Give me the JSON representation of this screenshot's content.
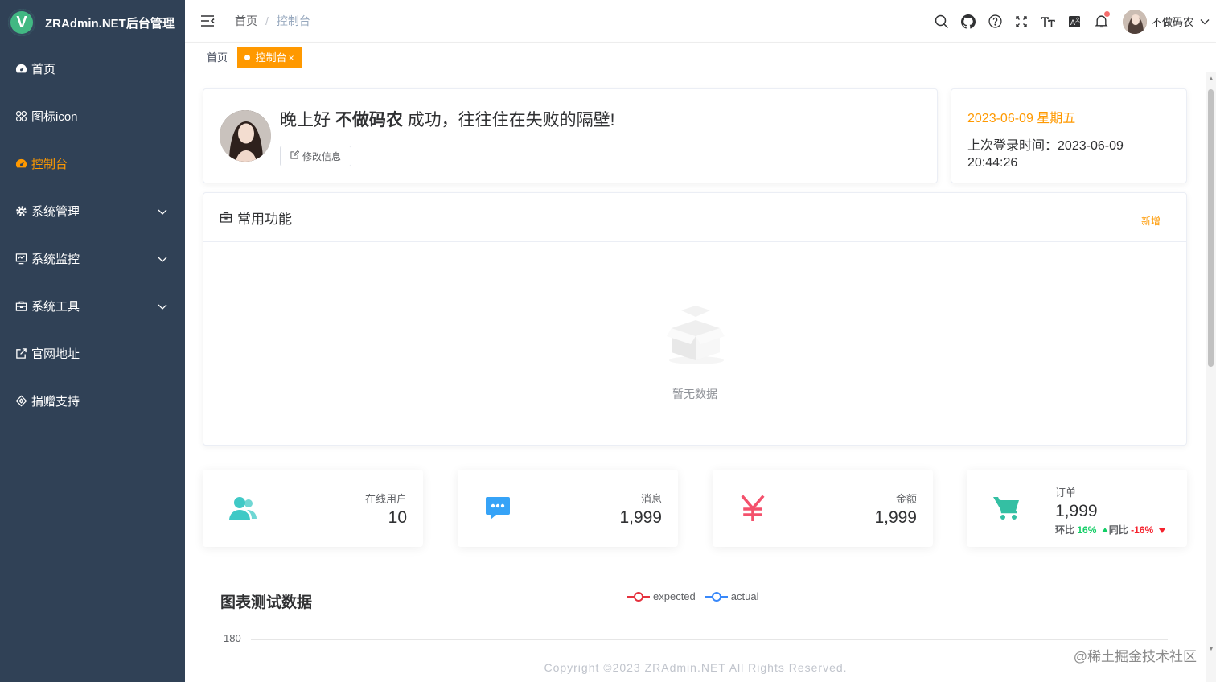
{
  "app": {
    "title": "ZRAdmin.NET后台管理",
    "logo_letter": "V"
  },
  "sidebar": {
    "items": [
      {
        "label": "首页",
        "icon": "dashboard-icon"
      },
      {
        "label": "图标icon",
        "icon": "grid-icon"
      },
      {
        "label": "控制台",
        "icon": "dashboard-icon",
        "active": true
      },
      {
        "label": "系统管理",
        "icon": "gear-icon",
        "expandable": true
      },
      {
        "label": "系统监控",
        "icon": "monitor-icon",
        "expandable": true
      },
      {
        "label": "系统工具",
        "icon": "toolbox-icon",
        "expandable": true
      },
      {
        "label": "官网地址",
        "icon": "external-link-icon"
      },
      {
        "label": "捐赠支持",
        "icon": "donate-icon"
      }
    ]
  },
  "header": {
    "breadcrumb": {
      "home": "首页",
      "sep": "/",
      "current": "控制台"
    },
    "icons": [
      "search-icon",
      "github-icon",
      "help-icon",
      "fullscreen-icon",
      "font-size-icon",
      "translate-icon",
      "bell-icon"
    ],
    "user": {
      "name": "不做码农"
    }
  },
  "tags": {
    "home": "首页",
    "active": "控制台",
    "close": "×"
  },
  "welcome": {
    "prefix": "晚上好",
    "name": "不做码农",
    "suffix": "成功，往往住在失败的隔壁!",
    "edit_label": "修改信息"
  },
  "date_card": {
    "date": "2023-06-09 星期五",
    "last_login_label": "上次登录时间：",
    "last_login_value": "2023-06-09 20:44:26"
  },
  "functions": {
    "title": "常用功能",
    "add_label": "新增",
    "empty_text": "暂无数据"
  },
  "stats": [
    {
      "label": "在线用户",
      "value": "10",
      "icon": "users-icon",
      "color": "#40c9c6"
    },
    {
      "label": "消息",
      "value": "1,999",
      "icon": "message-icon",
      "color": "#36a3f7"
    },
    {
      "label": "金额",
      "value": "1,999",
      "icon": "yen-icon",
      "color": "#f4516c"
    },
    {
      "label": "订单",
      "value": "1,999",
      "icon": "cart-icon",
      "color": "#34bfa3",
      "trend": {
        "mom_label": "环比",
        "mom_value": "16%",
        "yoy_label": "同比",
        "yoy_value": "-16%"
      }
    }
  ],
  "chart": {
    "title": "图表测试数据",
    "legend": [
      {
        "name": "expected",
        "color": "#e5323e"
      },
      {
        "name": "actual",
        "color": "#3888fa"
      }
    ],
    "y_tick": "180"
  },
  "footer": {
    "text": "Copyright ©2023 ZRAdmin.NET All Rights Reserved."
  },
  "watermark": "@稀土掘金技术社区",
  "colors": {
    "sidebar": "#304156",
    "accent": "#ff9900",
    "up": "#13ce66",
    "down": "#f5222d"
  }
}
